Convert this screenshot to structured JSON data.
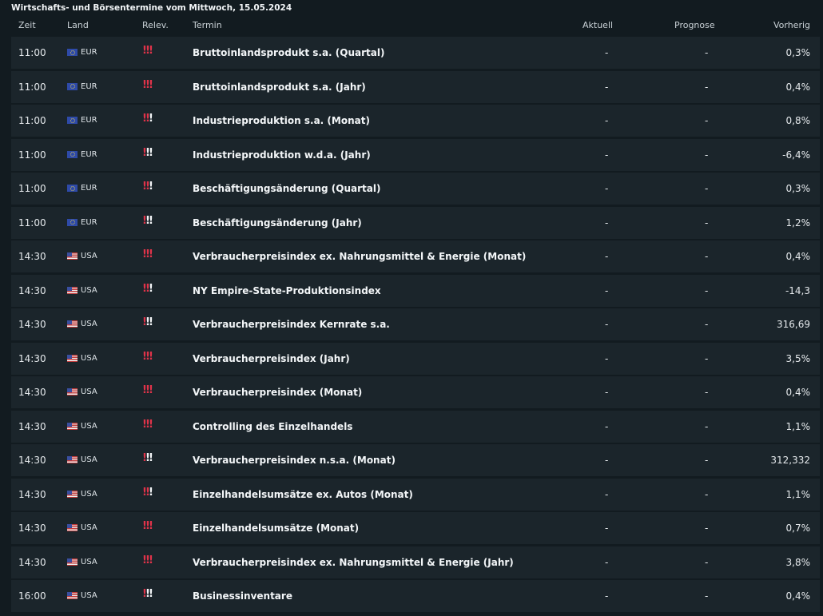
{
  "title": "Wirtschafts- und Börsentermine vom Mittwoch, 15.05.2024",
  "columns": {
    "zeit": "Zeit",
    "land": "Land",
    "relev": "Relev.",
    "termin": "Termin",
    "aktuell": "Aktuell",
    "prognose": "Prognose",
    "vorherig": "Vorherig"
  },
  "colors": {
    "background": "#121b20",
    "row": "#1b252b",
    "relevance_high": "#e0334a",
    "relevance_low": "#f3f5f7"
  },
  "rows": [
    {
      "zeit": "11:00",
      "land": "EUR",
      "flag": "eu-flag-icon",
      "relevance": 3,
      "termin": "Bruttoinlandsprodukt s.a. (Quartal)",
      "aktuell": "-",
      "prognose": "-",
      "vorherig": "0,3%"
    },
    {
      "zeit": "11:00",
      "land": "EUR",
      "flag": "eu-flag-icon",
      "relevance": 3,
      "termin": "Bruttoinlandsprodukt s.a. (Jahr)",
      "aktuell": "-",
      "prognose": "-",
      "vorherig": "0,4%"
    },
    {
      "zeit": "11:00",
      "land": "EUR",
      "flag": "eu-flag-icon",
      "relevance": 2,
      "termin": "Industrieproduktion s.a. (Monat)",
      "aktuell": "-",
      "prognose": "-",
      "vorherig": "0,8%"
    },
    {
      "zeit": "11:00",
      "land": "EUR",
      "flag": "eu-flag-icon",
      "relevance": 1,
      "termin": "Industrieproduktion w.d.a. (Jahr)",
      "aktuell": "-",
      "prognose": "-",
      "vorherig": "-6,4%"
    },
    {
      "zeit": "11:00",
      "land": "EUR",
      "flag": "eu-flag-icon",
      "relevance": 2,
      "termin": "Beschäftigungsänderung (Quartal)",
      "aktuell": "-",
      "prognose": "-",
      "vorherig": "0,3%"
    },
    {
      "zeit": "11:00",
      "land": "EUR",
      "flag": "eu-flag-icon",
      "relevance": 1,
      "termin": "Beschäftigungsänderung (Jahr)",
      "aktuell": "-",
      "prognose": "-",
      "vorherig": "1,2%"
    },
    {
      "zeit": "14:30",
      "land": "USA",
      "flag": "us-flag-icon",
      "relevance": 3,
      "termin": "Verbraucherpreisindex ex. Nahrungsmittel & Energie (Monat)",
      "aktuell": "-",
      "prognose": "-",
      "vorherig": "0,4%"
    },
    {
      "zeit": "14:30",
      "land": "USA",
      "flag": "us-flag-icon",
      "relevance": 2,
      "termin": "NY Empire-State-Produktionsindex",
      "aktuell": "-",
      "prognose": "-",
      "vorherig": "-14,3"
    },
    {
      "zeit": "14:30",
      "land": "USA",
      "flag": "us-flag-icon",
      "relevance": 1,
      "termin": "Verbraucherpreisindex Kernrate s.a.",
      "aktuell": "-",
      "prognose": "-",
      "vorherig": "316,69"
    },
    {
      "zeit": "14:30",
      "land": "USA",
      "flag": "us-flag-icon",
      "relevance": 3,
      "termin": "Verbraucherpreisindex (Jahr)",
      "aktuell": "-",
      "prognose": "-",
      "vorherig": "3,5%"
    },
    {
      "zeit": "14:30",
      "land": "USA",
      "flag": "us-flag-icon",
      "relevance": 3,
      "termin": "Verbraucherpreisindex (Monat)",
      "aktuell": "-",
      "prognose": "-",
      "vorherig": "0,4%"
    },
    {
      "zeit": "14:30",
      "land": "USA",
      "flag": "us-flag-icon",
      "relevance": 3,
      "termin": "Controlling des Einzelhandels",
      "aktuell": "-",
      "prognose": "-",
      "vorherig": "1,1%"
    },
    {
      "zeit": "14:30",
      "land": "USA",
      "flag": "us-flag-icon",
      "relevance": 1,
      "termin": "Verbraucherpreisindex n.s.a. (Monat)",
      "aktuell": "-",
      "prognose": "-",
      "vorherig": "312,332"
    },
    {
      "zeit": "14:30",
      "land": "USA",
      "flag": "us-flag-icon",
      "relevance": 2,
      "termin": "Einzelhandelsumsätze ex. Autos (Monat)",
      "aktuell": "-",
      "prognose": "-",
      "vorherig": "1,1%"
    },
    {
      "zeit": "14:30",
      "land": "USA",
      "flag": "us-flag-icon",
      "relevance": 3,
      "termin": "Einzelhandelsumsätze (Monat)",
      "aktuell": "-",
      "prognose": "-",
      "vorherig": "0,7%"
    },
    {
      "zeit": "14:30",
      "land": "USA",
      "flag": "us-flag-icon",
      "relevance": 3,
      "termin": "Verbraucherpreisindex ex. Nahrungsmittel & Energie (Jahr)",
      "aktuell": "-",
      "prognose": "-",
      "vorherig": "3,8%"
    },
    {
      "zeit": "16:00",
      "land": "USA",
      "flag": "us-flag-icon",
      "relevance": 1,
      "termin": "Businessinventare",
      "aktuell": "-",
      "prognose": "-",
      "vorherig": "0,4%"
    }
  ]
}
